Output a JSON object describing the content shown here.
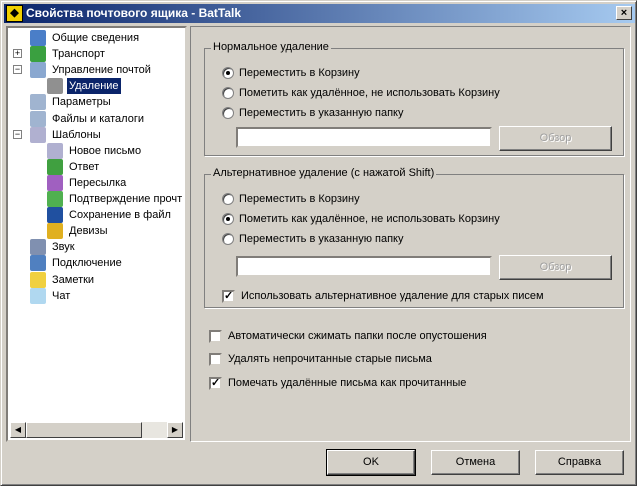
{
  "window": {
    "title": "Свойства почтового ящика - BatTalk",
    "close": "×"
  },
  "tree": [
    {
      "label": "Общие сведения",
      "icon": "user-icon",
      "color": "#4a7ec8"
    },
    {
      "label": "Транспорт",
      "icon": "transport-icon",
      "color": "#3aa040",
      "expander": "+"
    },
    {
      "label": "Управление почтой",
      "icon": "mail-management-icon",
      "color": "#8aa8d0",
      "expander": "−"
    },
    {
      "label": "Удаление",
      "icon": "trash-icon",
      "color": "#909090",
      "selected": true
    },
    {
      "label": "Параметры",
      "icon": "parameters-icon",
      "color": "#a0b4d0"
    },
    {
      "label": "Файлы и каталоги",
      "icon": "folders-icon",
      "color": "#a0b4d0"
    },
    {
      "label": "Шаблоны",
      "icon": "templates-icon",
      "color": "#b0b0d0",
      "expander": "−"
    },
    {
      "label": "Новое письмо",
      "icon": "new-letter-icon",
      "color": "#b0b0d0"
    },
    {
      "label": "Ответ",
      "icon": "reply-icon",
      "color": "#40a040"
    },
    {
      "label": "Пересылка",
      "icon": "forward-icon",
      "color": "#a060c0"
    },
    {
      "label": "Подтверждение прочт",
      "icon": "read-confirm-icon",
      "color": "#50b050"
    },
    {
      "label": "Сохранение в файл",
      "icon": "save-icon",
      "color": "#2050a0"
    },
    {
      "label": "Девизы",
      "icon": "coins-icon",
      "color": "#e0b020"
    },
    {
      "label": "Звук",
      "icon": "speaker-icon",
      "color": "#8090b0"
    },
    {
      "label": "Подключение",
      "icon": "network-icon",
      "color": "#5080c0"
    },
    {
      "label": "Заметки",
      "icon": "notes-icon",
      "color": "#f0d040"
    },
    {
      "label": "Чат",
      "icon": "chat-icon",
      "color": "#b0d8f0"
    }
  ],
  "normal": {
    "title": "Нормальное удаление",
    "options": [
      "Переместить в Корзину",
      "Пометить как удалённое, не использовать Корзину",
      "Переместить в указанную папку"
    ],
    "selected": 0,
    "folder": "",
    "browse": "Обзор"
  },
  "alt": {
    "title": "Альтернативное удаление (с нажатой Shift)",
    "options": [
      "Переместить в Корзину",
      "Пометить как удалённое, не использовать Корзину",
      "Переместить в указанную папку"
    ],
    "selected": 1,
    "folder": "",
    "browse": "Обзор",
    "use_old": "Использовать альтернативное удаление для старых писем"
  },
  "checks": [
    {
      "label": "Автоматически сжимать папки после опустошения",
      "checked": false
    },
    {
      "label": "Удалять непрочитанные старые письма",
      "checked": false
    },
    {
      "label": "Помечать удалённые письма как прочитанные",
      "checked": true
    }
  ],
  "buttons": {
    "ok": "OK",
    "cancel": "Отмена",
    "help": "Справка"
  }
}
